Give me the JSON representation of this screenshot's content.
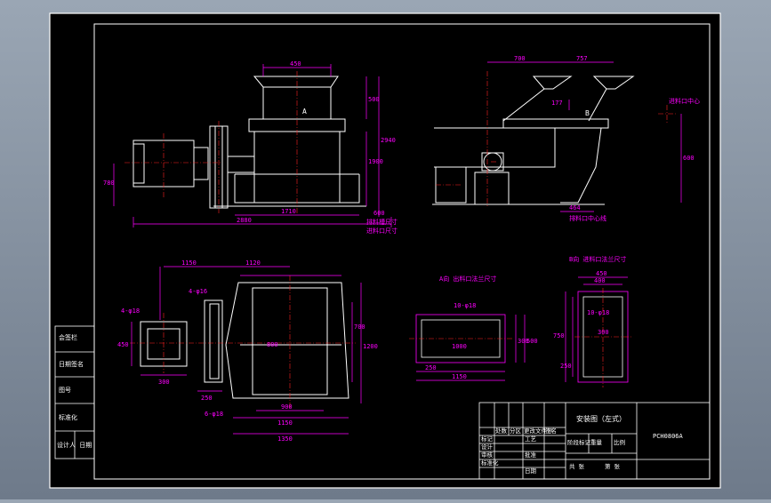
{
  "colors": {
    "paper": "#000000",
    "frame": "#ffffff",
    "dimension": "#ff00ff",
    "center_line": "#ff2020",
    "equipment": "#ffffff"
  },
  "front_view": {
    "dims": {
      "hopper_width": "450",
      "hopper_height": "500",
      "top_height": "2940",
      "mid_height": "1900",
      "motor_height": "780",
      "base_width": "1710",
      "total_width": "2880",
      "right_offset": "600"
    },
    "section_mark": "A",
    "discharge_label": "排料槽尺寸",
    "inlet_label": "进料口尺寸"
  },
  "side_view": {
    "dims": {
      "left_top": "700",
      "right_top": "757",
      "height": "600",
      "base": "464",
      "vertical": "177"
    },
    "section_mark": "B",
    "inlet_label": "进料口中心",
    "outlet_label": "排料口中心线"
  },
  "plan_view": {
    "dims": {
      "top_a": "1150",
      "top_b": "1120",
      "flange_bolts": "4-φ16",
      "side_bolts": "4-φ18",
      "height_a": "700",
      "height_b": "1200",
      "bottom_a": "1150",
      "bottom_b": "1350",
      "small_w": "300",
      "small_h": "450",
      "gap": "250",
      "wide": "900",
      "bolts_bottom": "6-φ18",
      "center_dim": "800"
    }
  },
  "flange_a": {
    "title": "A向 出料口法兰尺寸",
    "bolts": "10-φ18",
    "dims": {
      "inner_w": "1000",
      "h": "300",
      "w": "500",
      "seg": "250",
      "outer_w": "1150"
    }
  },
  "flange_b": {
    "title": "B向 进料口法兰尺寸",
    "bolts": "10-φ18",
    "dims": {
      "top_w": "450",
      "inner": "400",
      "side_h": "750",
      "inner_w": "300",
      "side_seg": "250"
    }
  },
  "left_strip": {
    "cells": [
      "会签栏",
      "日期签名",
      "图号",
      "标准化",
      "设计人 日期"
    ]
  },
  "title_block": {
    "drawing_title": "安装图（左式）",
    "drawing_no": "PCH0806A",
    "header_left": "标记",
    "header_qty": "处数",
    "header_doc": "分区",
    "header_sign": "更改文件号",
    "header_date": "签名",
    "row_design": "设计",
    "row_check": "审核",
    "row_std": "标准化",
    "row_process": "工艺",
    "row_approve": "批准",
    "row_date": "日期",
    "stage_label": "阶段标记",
    "weight_label": "重量",
    "scale_label": "比例",
    "sheet_total": "共 张",
    "sheet_no": "第 张"
  }
}
